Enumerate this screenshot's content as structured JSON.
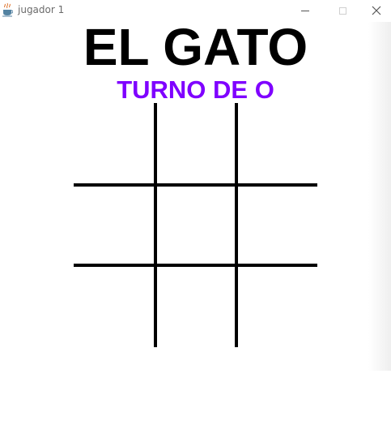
{
  "window": {
    "title": "jugador 1",
    "app_icon": "java-cup-icon",
    "controls": {
      "minimize_icon": "minimize-icon",
      "maximize_icon": "maximize-icon",
      "close_icon": "close-icon",
      "close_glyph": "✕"
    }
  },
  "game": {
    "title": "EL GATO",
    "turn_text": "TURNO DE O",
    "turn_color": "#7f00ff",
    "title_color": "#000000",
    "board": {
      "rows": 3,
      "cols": 3,
      "cells": [
        "",
        "",
        "",
        "",
        "",
        "",
        "",
        "",
        ""
      ]
    }
  }
}
